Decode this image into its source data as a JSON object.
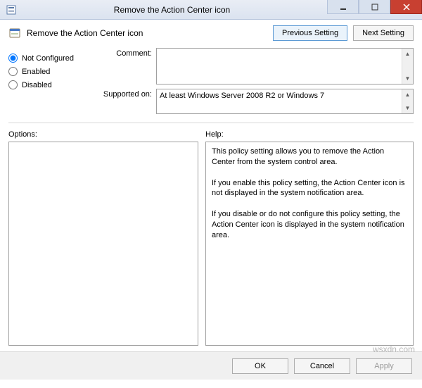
{
  "window": {
    "title": "Remove the Action Center icon"
  },
  "header": {
    "policy_title": "Remove the Action Center icon",
    "prev_btn": "Previous Setting",
    "next_btn": "Next Setting"
  },
  "radios": {
    "not_configured": "Not Configured",
    "enabled": "Enabled",
    "disabled": "Disabled",
    "selected": "not_configured"
  },
  "fields": {
    "comment_label": "Comment:",
    "comment_value": "",
    "supported_label": "Supported on:",
    "supported_value": "At least Windows Server 2008 R2 or Windows 7"
  },
  "lower": {
    "options_label": "Options:",
    "help_label": "Help:",
    "help_p1": "This policy setting allows you to remove the Action Center from the system control area.",
    "help_p2": "If you enable this policy setting, the Action Center icon is not displayed in the system notification area.",
    "help_p3": "If you disable or do not configure this policy setting, the Action Center icon is displayed in the system notification area."
  },
  "footer": {
    "ok": "OK",
    "cancel": "Cancel",
    "apply": "Apply"
  },
  "watermark": "wsxdn.com"
}
